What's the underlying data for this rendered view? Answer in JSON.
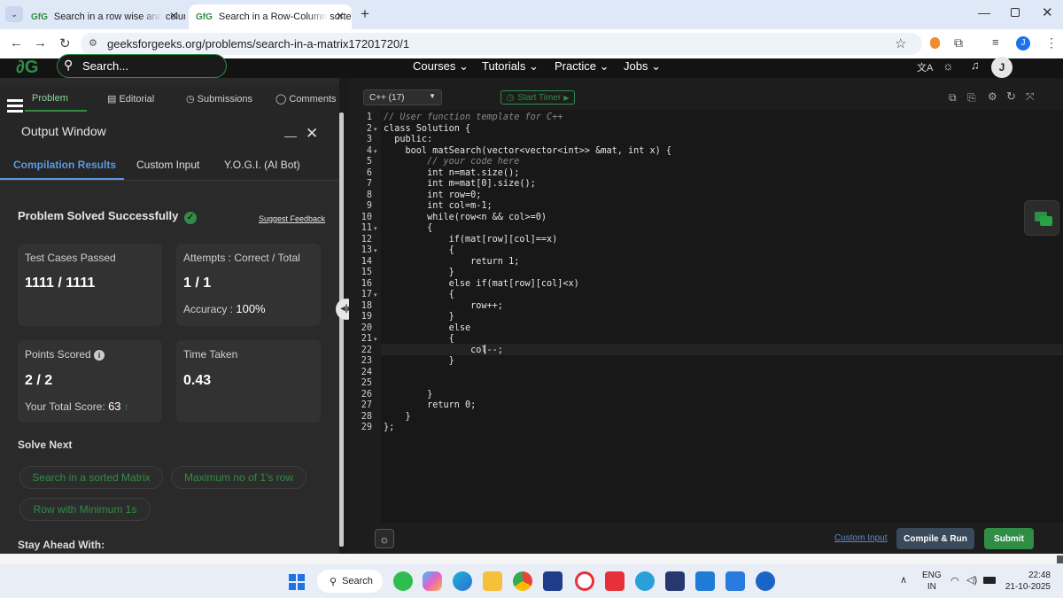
{
  "browser": {
    "tabs": [
      {
        "title": "Search in a row wise and colum",
        "favicon": "GfG"
      },
      {
        "title": "Search in a Row-Column sorted",
        "favicon": "GfG"
      }
    ],
    "url": "geeksforgeeks.org/problems/search-in-a-matrix17201720/1",
    "profile_initial": "J"
  },
  "site_nav": {
    "search_placeholder": "Search...",
    "links": [
      "Courses",
      "Tutorials",
      "Practice",
      "Jobs"
    ],
    "avatar_initial": "J"
  },
  "left_tabs": [
    "Problem",
    "Editorial",
    "Submissions",
    "Comments"
  ],
  "output_window": {
    "title": "Output Window",
    "tabs": [
      "Compilation Results",
      "Custom Input",
      "Y.O.G.I. (AI Bot)"
    ],
    "status": "Problem Solved Successfully",
    "feedback_link": "Suggest Feedback",
    "cards": {
      "test_cases_label": "Test Cases Passed",
      "test_cases_value": "1111 / 1111",
      "attempts_label": "Attempts : Correct / Total",
      "attempts_value": "1 / 1",
      "accuracy_label": "Accuracy :",
      "accuracy_value": "100%",
      "points_label": "Points Scored",
      "points_value": "2 / 2",
      "total_score_label": "Your Total Score:",
      "total_score_value": "63",
      "time_label": "Time Taken",
      "time_value": "0.43"
    },
    "solve_next_title": "Solve Next",
    "solve_next": [
      "Search in a sorted Matrix",
      "Maximum no of 1's row",
      "Row with Minimum 1s"
    ],
    "stay_ahead": "Stay Ahead With:"
  },
  "editor": {
    "language": "C++ (17)",
    "timer_label": "Start Timer",
    "code_lines": [
      "// User function template for C++",
      "class Solution {",
      "  public:",
      "    bool matSearch(vector<vector<int>> &mat, int x) {",
      "        // your code here",
      "        int n=mat.size();",
      "        int m=mat[0].size();",
      "        int row=0;",
      "        int col=m-1;",
      "        while(row<n && col>=0)",
      "        {",
      "            if(mat[row][col]==x)",
      "            {",
      "                return 1;",
      "            }",
      "            else if(mat[row][col]<x)",
      "            {",
      "                row++;",
      "            }",
      "            else",
      "            {",
      "                col--;",
      "            }",
      "",
      "",
      "        }",
      "        return 0;",
      "    }",
      "};"
    ],
    "custom_input_link": "Custom Input",
    "compile_label": "Compile & Run",
    "submit_label": "Submit"
  },
  "taskbar": {
    "search_label": "Search",
    "lang_top": "ENG",
    "lang_bottom": "IN",
    "time": "22:48",
    "date": "21-10-2025"
  },
  "colors": {
    "brand_green": "#2f8d46",
    "accent_blue": "#1a73e8"
  }
}
